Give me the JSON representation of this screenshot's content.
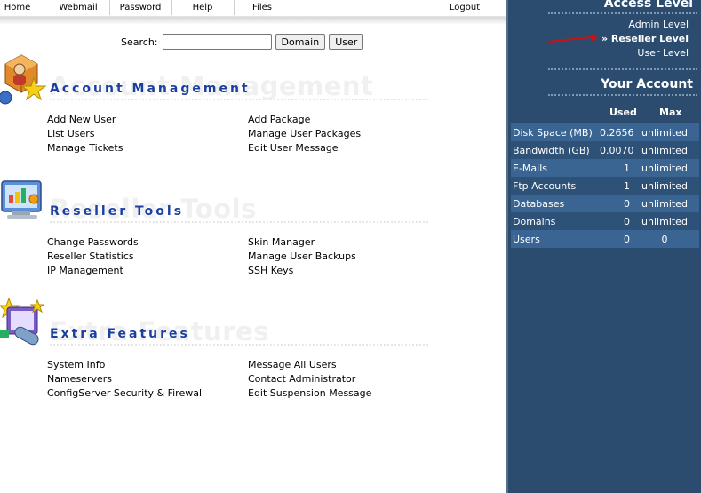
{
  "nav": {
    "items": [
      "Home",
      "Webmail",
      "Password",
      "Help",
      "Files",
      "Logout"
    ]
  },
  "search": {
    "label": "Search:",
    "value": "",
    "placeholder": "",
    "domain_button": "Domain",
    "user_button": "User"
  },
  "sections": [
    {
      "title": "Account Management",
      "watermark": "Account Management",
      "icon": "account-management-icon",
      "links": [
        "Add New User",
        "Add Package",
        "List Users",
        "Manage User Packages",
        "Manage Tickets",
        "Edit User Message"
      ]
    },
    {
      "title": "Reseller Tools",
      "watermark": "Reseller Tools",
      "icon": "reseller-tools-icon",
      "links": [
        "Change Passwords",
        "Skin Manager",
        "Reseller Statistics",
        "Manage User Backups",
        "IP Management",
        "SSH Keys"
      ]
    },
    {
      "title": "Extra Features",
      "watermark": "Extra Features",
      "icon": "extra-features-icon",
      "links": [
        "System Info",
        "Message All Users",
        "Nameservers",
        "Contact Administrator",
        "ConfigServer Security & Firewall",
        "Edit Suspension Message"
      ]
    }
  ],
  "panel": {
    "access_level_title": "Access Level",
    "levels": [
      "Admin Level",
      "» Reseller Level",
      "User Level"
    ],
    "active_level": "Reseller Level",
    "your_account_title": "Your Account",
    "columns": [
      "Used",
      "Max"
    ],
    "rows": [
      {
        "name": "Disk Space (MB)",
        "used": "0.2656",
        "max": "unlimited"
      },
      {
        "name": "Bandwidth (GB)",
        "used": "0.0070",
        "max": "unlimited"
      },
      {
        "name": "E-Mails",
        "used": "1",
        "max": "unlimited"
      },
      {
        "name": "Ftp Accounts",
        "used": "1",
        "max": "unlimited"
      },
      {
        "name": "Databases",
        "used": "0",
        "max": "unlimited"
      },
      {
        "name": "Domains",
        "used": "0",
        "max": "unlimited"
      },
      {
        "name": "Users",
        "used": "0",
        "max": "0"
      }
    ]
  },
  "colors": {
    "panel_bg": "#2b4c6f",
    "section_title": "#1a3fa0",
    "annotation_arrow": "#cc1111"
  }
}
